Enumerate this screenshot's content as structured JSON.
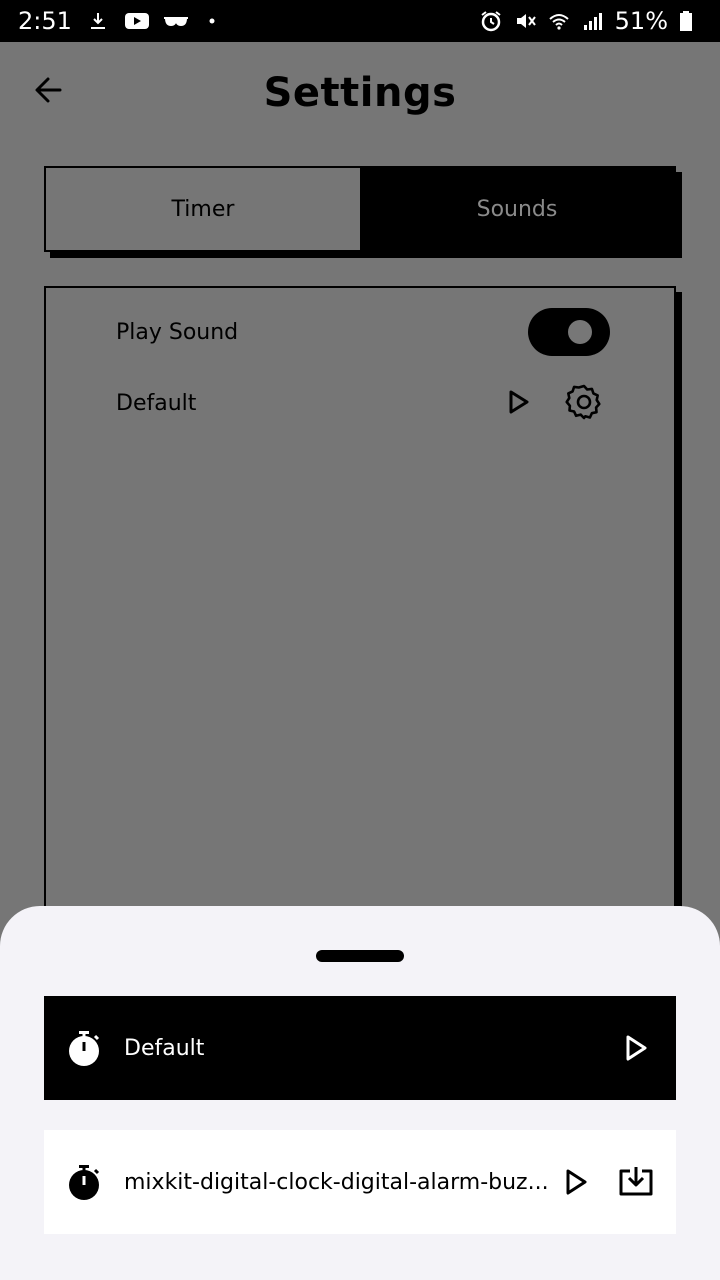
{
  "status_bar": {
    "time": "2:51",
    "battery": "51%",
    "icons": [
      "download-icon",
      "youtube-icon",
      "glasses-icon",
      "dot-icon",
      "alarm-icon",
      "mute-icon",
      "wifi-icon",
      "signal-icon",
      "battery-icon"
    ]
  },
  "header": {
    "title": "Settings",
    "back_icon": "arrow-left-icon"
  },
  "tabs": [
    {
      "label": "Timer",
      "selected": false
    },
    {
      "label": "Sounds",
      "selected": true
    }
  ],
  "panel": {
    "play_sound_label": "Play Sound",
    "play_sound_enabled": true,
    "sound_name": "Default",
    "play_icon": "play-icon",
    "settings_icon": "gear-icon"
  },
  "sheet": {
    "items": [
      {
        "label": "Default",
        "icon": "stopwatch-icon",
        "selected": true
      },
      {
        "label": "mixkit-digital-clock-digital-alarm-buz...",
        "icon": "stopwatch-icon",
        "selected": false
      }
    ]
  },
  "colors": {
    "scrim": "#767676",
    "sheet_bg": "#f4f3f8",
    "accent": "#000000"
  }
}
